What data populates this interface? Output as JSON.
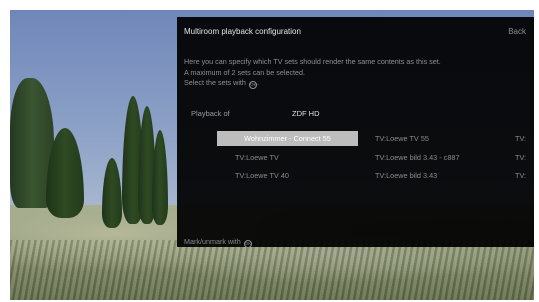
{
  "panel": {
    "title": "Multiroom playback configuration",
    "back_label": "Back",
    "description": [
      "Here you can specify which TV sets should render the same contents as this set.",
      "A maximum of 2 sets can be selected.",
      "Select the sets with"
    ],
    "ok_button_glyph": "OK",
    "playback_of_label": "Playback of",
    "playback_of_value": "ZDF HD",
    "tv_sets": [
      {
        "name": "Wohnzimmer - Connect 55",
        "selected": true
      },
      {
        "name": "TV:Loewe TV 55",
        "selected": false
      },
      {
        "name": "TV:",
        "selected": false
      },
      {
        "name": "TV:Loewe TV",
        "selected": false
      },
      {
        "name": "TV:Loewe bild 3.43 - c887",
        "selected": false
      },
      {
        "name": "TV:",
        "selected": false
      },
      {
        "name": "TV:Loewe TV 40",
        "selected": false
      },
      {
        "name": "TV:Loewe bild 3.43",
        "selected": false
      },
      {
        "name": "TV:",
        "selected": false
      }
    ],
    "mark_hint": "Mark/unmark with"
  },
  "colors": {
    "panel_background": "#000000",
    "selected_item_background": "#bdbdbd"
  },
  "icons": {
    "ok_button": "ok-button-icon"
  }
}
